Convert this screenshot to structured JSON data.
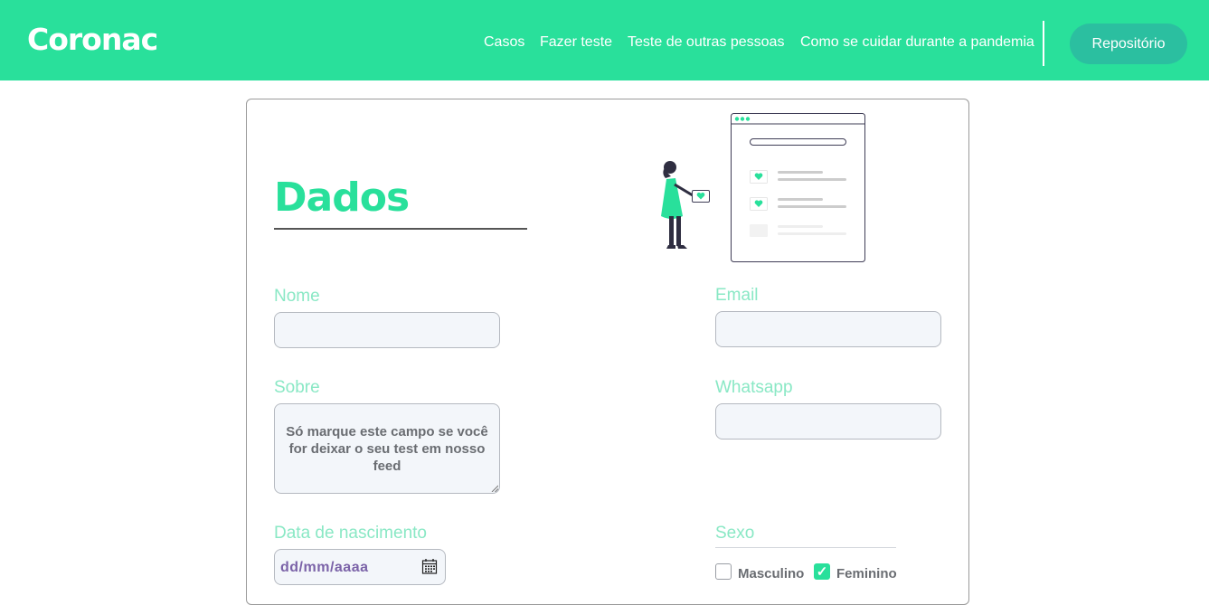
{
  "header": {
    "logo": "Coronac",
    "nav": [
      "Casos",
      "Fazer teste",
      "Teste de outras pessoas",
      "Como se cuidar durante a pandemia"
    ],
    "repo_button": "Repositório"
  },
  "form": {
    "title": "Dados",
    "labels": {
      "nome": "Nome",
      "email": "Email",
      "sobre": "Sobre",
      "whatsapp": "Whatsapp",
      "nascimento": "Data de nascimento",
      "sexo": "Sexo"
    },
    "sobre_placeholder": "Só marque este campo se você for deixar o seu test em nosso feed",
    "date_placeholder": "dd/mm/aaaa",
    "sexo_options": [
      {
        "label": "Masculino",
        "checked": false
      },
      {
        "label": "Feminino",
        "checked": true
      }
    ]
  },
  "colors": {
    "accent": "#29e09b",
    "button": "#2bbfa0",
    "label": "#8ae8c5"
  }
}
